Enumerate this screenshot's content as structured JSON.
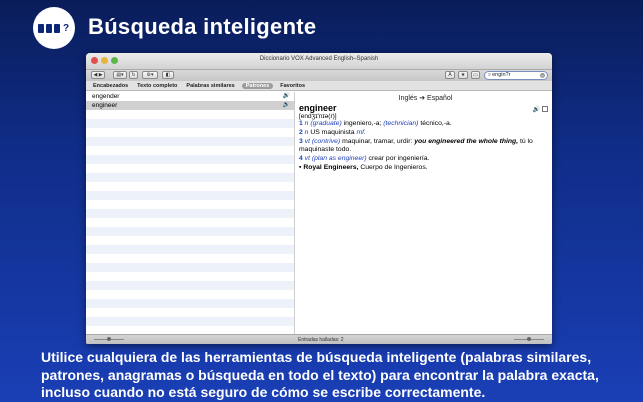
{
  "header": {
    "badge": {
      "squares": 3,
      "glyph": "?"
    },
    "title": "Búsqueda inteligente"
  },
  "window": {
    "title": "Diccionario VOX Advanced English–Spanish",
    "search": {
      "value": "engin?r",
      "icon": "magnifier-icon"
    },
    "tabs": [
      "Encabezados",
      "Texto completo",
      "Palabras similares",
      "Patrones",
      "Favoritos"
    ],
    "active_tab": "Patrones",
    "list": {
      "items": [
        {
          "word": "engender",
          "icon": "speaker-icon"
        },
        {
          "word": "engineer",
          "icon": "speaker-icon",
          "selected": true
        }
      ]
    },
    "entry": {
      "direction": "Inglés ➔ Español",
      "headword": "engineer",
      "pronunciation": "[endʒɪ'nɪə(r)]",
      "senses": [
        {
          "num": "1",
          "label": "n",
          "gloss1": "(graduate)",
          "text1": "ingeniero,-a;",
          "gloss2": "(technician)",
          "text2": "técnico,-a."
        },
        {
          "num": "2",
          "label": "n",
          "text1": "US maquinista",
          "link": "mf."
        },
        {
          "num": "3",
          "label": "vt",
          "gloss1": "(contrive)",
          "text1": "maquinar, tramar, urdir:",
          "example": "you engineered the whole thing,",
          "text2": "tú lo maquinaste todo."
        },
        {
          "num": "4",
          "label": "vt",
          "gloss1": "(plan as engineer)",
          "text1": "crear por ingeniería."
        }
      ],
      "compound": {
        "bullet": "▪",
        "term": "Royal Engineers,",
        "translation": "Cuerpo de Ingenieros."
      }
    },
    "status": "Entradas halladas: 2"
  },
  "caption": "Utilice cualquiera de las herramientas de búsqueda inteligente (palabras similares, patrones, anagramas o búsqueda en todo el texto) para encontrar la palabra exacta, incluso cuando no está seguro de cómo se escribe correctamente.",
  "colors": {
    "background": "#0f2c86",
    "link": "#1b3fb8"
  }
}
